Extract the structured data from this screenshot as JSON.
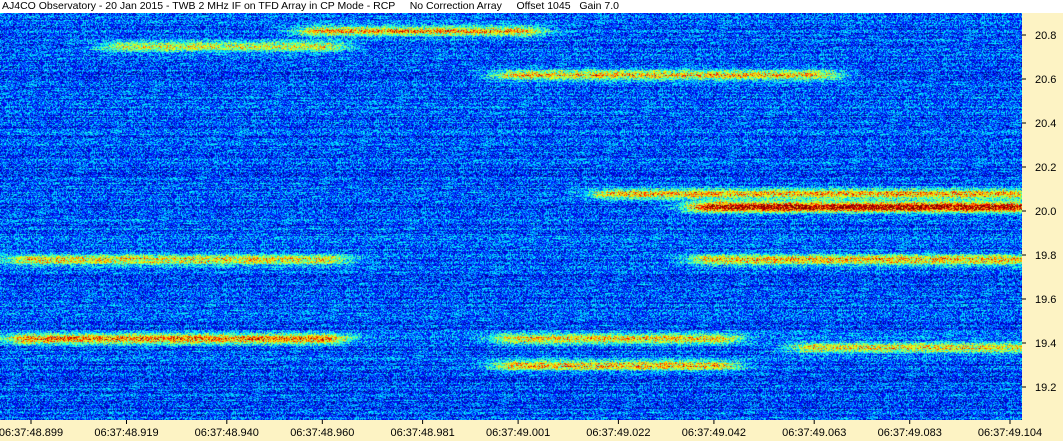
{
  "title": "AJ4CO Observatory - 20 Jan 2015 - TWB 2 MHz IF on TFD Array in CP Mode - RCP     No Correction Array     Offset 1045   Gain 7.0",
  "colors": {
    "background_low": "#0b1f9c",
    "mid": "#3a8ee6",
    "high": "#e9e13a",
    "peak": "#d24a7a",
    "axis_panel": "#fdf3c4",
    "tick": "#000000"
  },
  "chart_data": {
    "type": "heatmap",
    "title": "",
    "xlabel": "",
    "ylabel": "",
    "ylim": [
      19.05,
      20.9
    ],
    "yticks": [
      "20.8",
      "20.6",
      "20.4",
      "20.2",
      "20.0",
      "19.8",
      "19.6",
      "19.4",
      "19.2"
    ],
    "ytick_values": [
      20.8,
      20.6,
      20.4,
      20.2,
      20.0,
      19.8,
      19.6,
      19.4,
      19.2
    ],
    "xticks": [
      "06:37:48.899",
      "06:37:48.919",
      "06:37:48.940",
      "06:37:48.960",
      "06:37:48.981",
      "06:37:49.001",
      "06:37:49.022",
      "06:37:49.042",
      "06:37:49.063",
      "06:37:49.083",
      "06:37:49.104"
    ],
    "xlim": [
      "06:37:48.899",
      "06:37:49.104"
    ],
    "colormap": "jet",
    "y_axis_side": "right",
    "features": [
      {
        "freq": 20.82,
        "t_start": "06:37:48.960",
        "t_end": "06:37:49.001",
        "intensity": 0.55
      },
      {
        "freq": 20.75,
        "t_start": "06:37:48.919",
        "t_end": "06:37:48.960",
        "intensity": 0.45
      },
      {
        "freq": 20.62,
        "t_start": "06:37:49.001",
        "t_end": "06:37:49.063",
        "intensity": 0.55
      },
      {
        "freq": 20.02,
        "t_start": "06:37:49.042",
        "t_end": "06:37:49.104",
        "intensity": 0.9
      },
      {
        "freq": 20.08,
        "t_start": "06:37:49.022",
        "t_end": "06:37:49.104",
        "intensity": 0.55
      },
      {
        "freq": 19.78,
        "t_start": "06:37:48.899",
        "t_end": "06:37:48.960",
        "intensity": 0.5
      },
      {
        "freq": 19.78,
        "t_start": "06:37:49.042",
        "t_end": "06:37:49.104",
        "intensity": 0.55
      },
      {
        "freq": 19.42,
        "t_start": "06:37:48.899",
        "t_end": "06:37:48.960",
        "intensity": 0.6
      },
      {
        "freq": 19.42,
        "t_start": "06:37:49.001",
        "t_end": "06:37:49.042",
        "intensity": 0.5
      },
      {
        "freq": 19.3,
        "t_start": "06:37:49.001",
        "t_end": "06:37:49.042",
        "intensity": 0.55
      },
      {
        "freq": 19.38,
        "t_start": "06:37:49.063",
        "t_end": "06:37:49.104",
        "intensity": 0.5
      }
    ]
  }
}
